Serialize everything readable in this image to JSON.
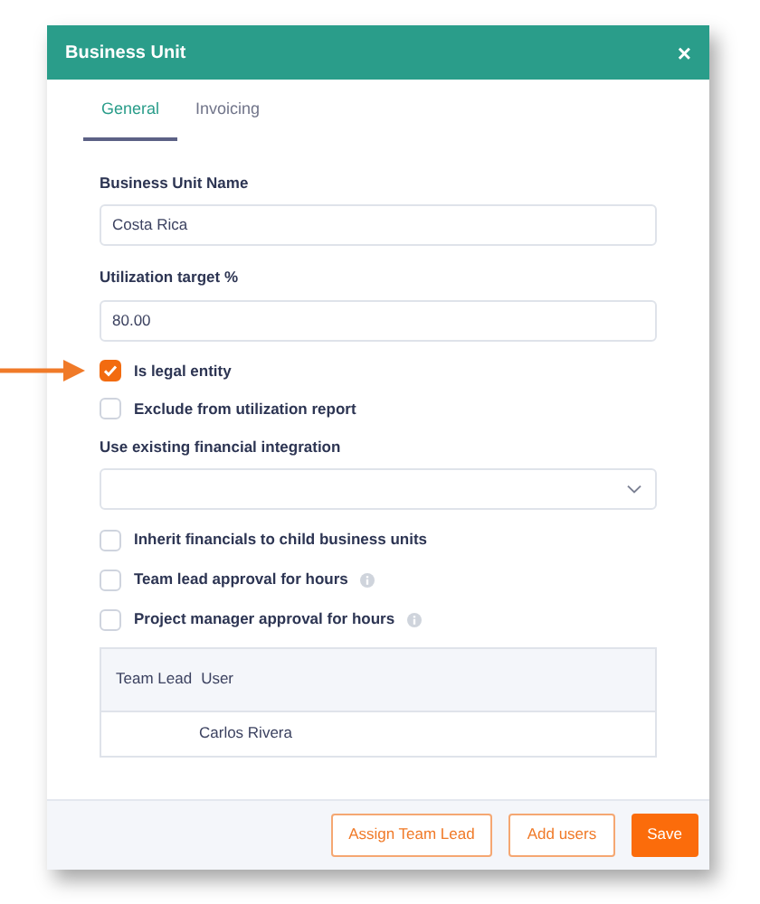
{
  "dialog": {
    "title": "Business Unit",
    "close": "×"
  },
  "tabs": [
    {
      "label": "General",
      "selected": true
    },
    {
      "label": "Invoicing",
      "selected": false
    }
  ],
  "name_field": {
    "label": "Business Unit Name",
    "value": "Costa Rica"
  },
  "target_field": {
    "label": "Utilization target %",
    "value": "80.00"
  },
  "options_top": [
    {
      "label": "Is legal entity",
      "checked": true,
      "highlighted": true
    },
    {
      "label": "Exclude from utilization report",
      "checked": false,
      "highlighted": false
    }
  ],
  "integration_select": {
    "label": "Use existing financial integration"
  },
  "options_bottom": [
    {
      "label": "Inherit financials to child business units",
      "checked": false,
      "kind": "plain"
    },
    {
      "label": "Team lead approval for hours",
      "checked": false,
      "kind": "info"
    },
    {
      "label": "Project manager approval for hours",
      "checked": false,
      "kind": "info"
    }
  ],
  "table": {
    "columns": [
      "Team Lead",
      "User"
    ],
    "rows": [
      [
        "",
        "Carlos Rivera"
      ]
    ]
  },
  "buttons": [
    {
      "label": "Assign Team Lead",
      "kind": "outline"
    },
    {
      "label": "Add users",
      "kind": "outline"
    },
    {
      "label": "Save",
      "kind": "primary"
    }
  ]
}
